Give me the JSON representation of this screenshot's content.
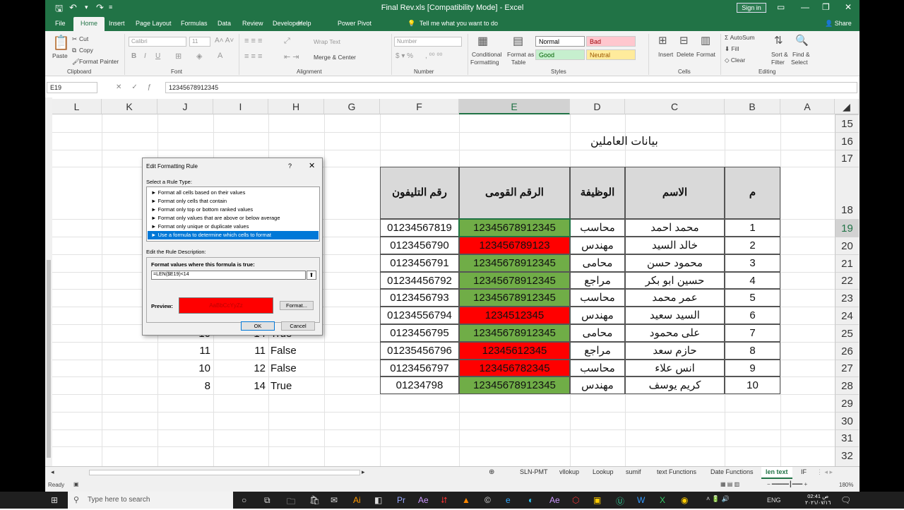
{
  "window": {
    "title": "Final Rev.xls  [Compatibility Mode]  -  Excel",
    "sign_in": "Sign in"
  },
  "menu": {
    "tabs": [
      "File",
      "Home",
      "Insert",
      "Page Layout",
      "Formulas",
      "Data",
      "Review",
      "Developer",
      "Help",
      "Power Pivot"
    ],
    "active_tab": "Home",
    "tell_me": "Tell me what you want to do",
    "share": "Share"
  },
  "ribbon": {
    "clipboard": {
      "paste": "Paste",
      "cut": "Cut",
      "copy": "Copy",
      "format_painter": "Format Painter",
      "label": "Clipboard"
    },
    "font": {
      "name": "Calibri",
      "size": "11",
      "label": "Font"
    },
    "alignment": {
      "wrap": "Wrap Text",
      "merge": "Merge & Center",
      "label": "Alignment"
    },
    "number": {
      "format": "Number",
      "label": "Number"
    },
    "styles": {
      "conditional": "Conditional",
      "conditional2": "Formatting",
      "format_as": "Format as",
      "format_as2": "Table",
      "normal": "Normal",
      "bad": "Bad",
      "good": "Good",
      "neutral": "Neutral",
      "label": "Styles"
    },
    "cells": {
      "insert": "Insert",
      "delete": "Delete",
      "format": "Format",
      "label": "Cells"
    },
    "editing": {
      "autosum": "AutoSum",
      "fill": "Fill",
      "clear": "Clear",
      "sort": "Sort &",
      "sort2": "Filter",
      "find": "Find &",
      "find2": "Select",
      "label": "Editing"
    }
  },
  "formula_bar": {
    "name_box": "E19",
    "formula": "12345678912345"
  },
  "columns": [
    "L",
    "K",
    "J",
    "I",
    "H",
    "G",
    "F",
    "E",
    "D",
    "C",
    "B",
    "A"
  ],
  "rows": [
    "15",
    "16",
    "17",
    "18",
    "19",
    "20",
    "21",
    "22",
    "23",
    "24",
    "25",
    "26",
    "27",
    "28",
    "29",
    "30",
    "31",
    "32"
  ],
  "sheet": {
    "title": "بيانات العاملين",
    "headers": {
      "phone": "رقم التليفون",
      "national_id": "الرقم القومى",
      "job": "الوظيفة",
      "name": "الاسم",
      "num": "م"
    },
    "records": [
      {
        "n": "1",
        "name": "محمد احمد",
        "job": "محاسب",
        "id": "12345678912345",
        "phone": "01234567819",
        "ok": true
      },
      {
        "n": "2",
        "name": "خالد السيد",
        "job": "مهندس",
        "id": "123456789123",
        "phone": "0123456790",
        "ok": false
      },
      {
        "n": "3",
        "name": "محمود حسن",
        "job": "محامى",
        "id": "12345678912345",
        "phone": "0123456791",
        "ok": true
      },
      {
        "n": "4",
        "name": "حسين ابو بكر",
        "job": "مراجع",
        "id": "12345678912345",
        "phone": "01234456792",
        "ok": true
      },
      {
        "n": "5",
        "name": "عمر محمد",
        "job": "محاسب",
        "id": "12345678912345",
        "phone": "0123456793",
        "ok": true
      },
      {
        "n": "6",
        "name": "السيد سعيد",
        "job": "مهندس",
        "id": "1234512345",
        "phone": "01234556794",
        "ok": false
      },
      {
        "n": "7",
        "name": "على محمود",
        "job": "محامى",
        "id": "12345678912345",
        "phone": "0123456795",
        "ok": true
      },
      {
        "n": "8",
        "name": "حازم سعد",
        "job": "مراجع",
        "id": "12345612345",
        "phone": "01235456796",
        "ok": false
      },
      {
        "n": "9",
        "name": "انس علاء",
        "job": "محاسب",
        "id": "123456782345",
        "phone": "0123456797",
        "ok": false
      },
      {
        "n": "10",
        "name": "كريم يوسف",
        "job": "مهندس",
        "id": "12345678912345",
        "phone": "01234798",
        "ok": true
      }
    ],
    "side_rows": [
      {
        "j": "10",
        "i": "14",
        "h": "True"
      },
      {
        "j": "11",
        "i": "11",
        "h": "False"
      },
      {
        "j": "10",
        "i": "12",
        "h": "False"
      },
      {
        "j": "8",
        "i": "14",
        "h": "True"
      }
    ]
  },
  "dialog": {
    "title": "Edit Formatting Rule",
    "select_type": "Select a Rule Type:",
    "rule_types": [
      "► Format all cells based on their values",
      "► Format only cells that contain",
      "► Format only top or bottom ranked values",
      "► Format only values that are above or below average",
      "► Format only unique or duplicate values",
      "► Use a formula to determine which cells to format"
    ],
    "edit_desc": "Edit the Rule Description:",
    "format_values": "Format values where this formula is true:",
    "formula": "=LEN($E19)<14",
    "preview_label": "Preview:",
    "preview_text": "AaBbCcYyZz",
    "format_btn": "Format...",
    "ok": "OK",
    "cancel": "Cancel"
  },
  "sheet_tabs": [
    "SLN-PMT",
    "vllokup",
    "Lookup",
    "sumif",
    "text Functions",
    "Date Functions",
    "len text",
    "IF"
  ],
  "active_sheet": "len text",
  "status": {
    "ready": "Ready",
    "zoom": "180%"
  },
  "taskbar": {
    "search": "Type here to search",
    "lang": "ENG",
    "time": "02:41 ص",
    "date": "٢٠٢١/٠٧/١٦"
  }
}
